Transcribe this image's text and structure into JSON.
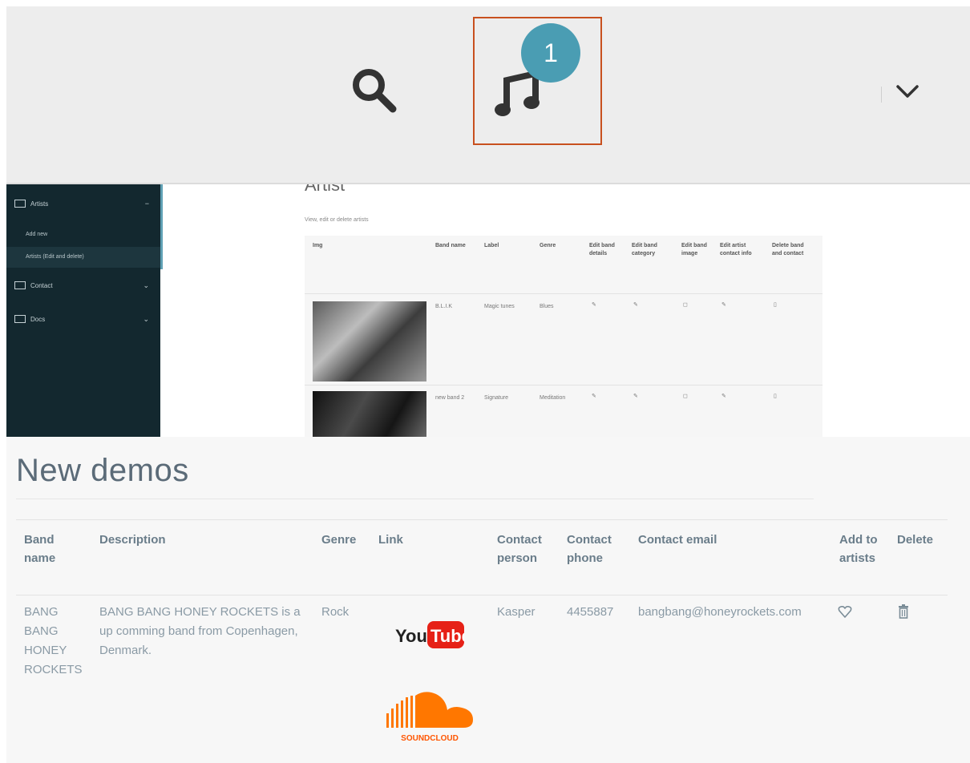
{
  "header": {
    "badge_count": "1",
    "icons": {
      "search": "search-icon",
      "music": "music-note-icon",
      "dropdown": "chevron-down-icon"
    }
  },
  "admin": {
    "title": "Artist",
    "subtitle": "View, edit or delete artists",
    "sidebar": {
      "items": [
        {
          "label": "Artists",
          "chevron": "−"
        },
        {
          "label": "Contact",
          "chevron": "⌄"
        },
        {
          "label": "Docs",
          "chevron": "⌄"
        }
      ],
      "subitems": [
        "Add new",
        "Artists (Edit and delete)"
      ]
    },
    "table": {
      "headers": [
        "Img",
        "Band name",
        "Label",
        "Genre",
        "Edit band details",
        "Edit band category",
        "Edit band image",
        "Edit artist contact info",
        "Delete band and contact"
      ],
      "rows": [
        {
          "band": "B.L.I.K",
          "label": "Magic tunes",
          "genre": "Blues"
        },
        {
          "band": "new band 2",
          "label": "Signature",
          "genre": "Meditation"
        }
      ]
    }
  },
  "demos": {
    "title": "New demos",
    "headers": {
      "band_name": "Band name",
      "description": "Description",
      "genre": "Genre",
      "link": "Link",
      "contact_person": "Contact person",
      "contact_phone": "Contact phone",
      "contact_email": "Contact email",
      "add_to_artists": "Add to artists",
      "delete": "Delete"
    },
    "rows": [
      {
        "band_name": "BANG BANG HONEY ROCKETS",
        "description": "BANG BANG HONEY ROCKETS is a up comming band from Copenhagen, Denmark.",
        "genre": "Rock",
        "youtube_you": "You",
        "youtube_tube": "Tube",
        "soundcloud": "SOUNDCLOUD",
        "contact_person": "Kasper",
        "contact_phone": "4455887",
        "contact_email": "bangbang@honeyrockets.com"
      }
    ]
  },
  "colors": {
    "accent": "#4a9db3",
    "highlight_border": "#c8501e",
    "sidebar": "#13282f",
    "youtube_red": "#e62117",
    "soundcloud_orange": "#ff7700"
  }
}
